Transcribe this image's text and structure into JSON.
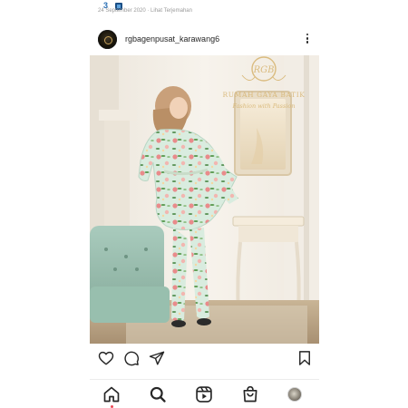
{
  "status_bar": {
    "notification_count": "3",
    "date_text": "24 September 2020 · Lihat Terjemahan"
  },
  "post": {
    "username": "rgbagenpusat_karawang6",
    "photo_overlay": {
      "brand_name": "RUMAH GAYA BATIK",
      "tagline": "Fashion with Passion",
      "monogram": "RGB"
    }
  },
  "actions": {
    "icons": [
      "heart-icon",
      "comment-icon",
      "share-icon",
      "bookmark-icon"
    ]
  },
  "bottom_nav": {
    "items": [
      "home-icon",
      "search-icon",
      "reels-icon",
      "shop-icon",
      "profile-avatar"
    ],
    "has_notification_dot": true
  },
  "colors": {
    "text": "#262626",
    "notification_dot": "#ed4956",
    "divider": "#ececec",
    "watermark_gold": "#d6b36e"
  }
}
